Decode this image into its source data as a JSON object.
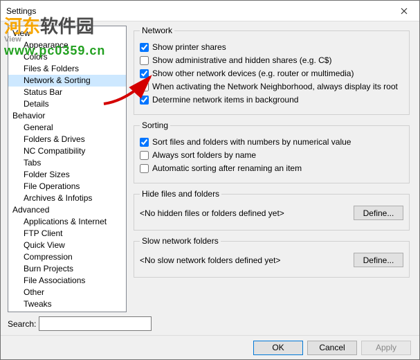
{
  "title": "Settings",
  "watermark": {
    "cn_a": "河东",
    "cn_b": "软件园",
    "sub": "View",
    "url": "www.pc0359.cn"
  },
  "tree": {
    "view": "View",
    "items_view": [
      "Appearance",
      "Colors",
      "Files & Folders",
      "Network & Sorting",
      "Status Bar",
      "Details"
    ],
    "behavior": "Behavior",
    "items_behavior": [
      "General",
      "Folders & Drives",
      "NC Compatibility",
      "Tabs",
      "Folder Sizes",
      "File Operations",
      "Archives & Infotips"
    ],
    "advanced": "Advanced",
    "items_advanced": [
      "Applications & Internet",
      "FTP Client",
      "Quick View",
      "Compression",
      "Burn Projects",
      "File Associations",
      "Other",
      "Tweaks"
    ]
  },
  "selected": "Network & Sorting",
  "search_label": "Search:",
  "groups": {
    "network": {
      "legend": "Network",
      "opt1": "Show printer shares",
      "opt2": "Show administrative and hidden shares (e.g. C$)",
      "opt3": "Show other network devices (e.g. router or multimedia)",
      "opt4": "When activating the Network Neighborhood, always display its root",
      "opt5": "Determine network items in background"
    },
    "sorting": {
      "legend": "Sorting",
      "opt1": "Sort files and folders with numbers by numerical value",
      "opt2": "Always sort folders by name",
      "opt3": "Automatic sorting after renaming an item"
    },
    "hide": {
      "legend": "Hide files and folders",
      "msg": "<No hidden files or folders defined yet>",
      "define": "Define..."
    },
    "slow": {
      "legend": "Slow network folders",
      "msg": "<No slow network folders defined yet>",
      "define": "Define..."
    }
  },
  "buttons": {
    "ok": "OK",
    "cancel": "Cancel",
    "apply": "Apply"
  },
  "checked": {
    "net1": true,
    "net2": false,
    "net3": true,
    "net4": false,
    "net5": true,
    "sort1": true,
    "sort2": false,
    "sort3": false
  }
}
